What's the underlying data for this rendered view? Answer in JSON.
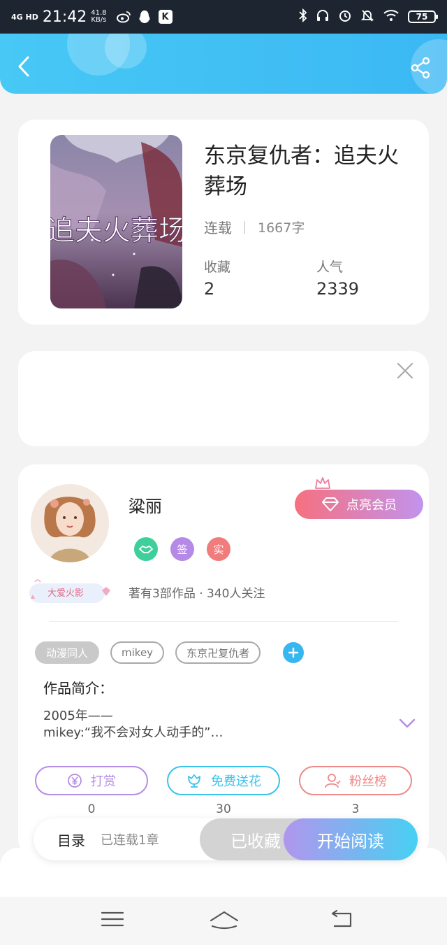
{
  "status_bar": {
    "signal": "4G HD",
    "time": "21:42",
    "net_speed_value": "41.8",
    "net_speed_unit": "KB/s",
    "k_app_label": "K",
    "battery": "75"
  },
  "header": {
    "back_icon": "chevron-left-icon",
    "share_icon": "share-icon"
  },
  "book": {
    "title": "东京复仇者：追夫火葬场",
    "status": "连载",
    "word_count": "1667字",
    "favorites_label": "收藏",
    "favorites_value": "2",
    "popularity_label": "人气",
    "popularity_value": "2339",
    "cover_text": "追夫火葬场"
  },
  "ad": {
    "close_icon": "close-icon"
  },
  "author": {
    "name": "粱丽",
    "badges": [
      {
        "icon": "handshake-icon",
        "label": "",
        "color": "#3ecf9b"
      },
      {
        "icon": "signed-icon",
        "label": "签",
        "color": "#b58ae6"
      },
      {
        "icon": "verified-icon",
        "label": "实",
        "color": "#f07c7c"
      }
    ],
    "vip_label": "点亮会员",
    "fan_tag": "大爱火影",
    "works_info": "著有3部作品 · 340人关注"
  },
  "tags": [
    "动漫同人",
    "mikey",
    "东京卍复仇者"
  ],
  "intro": {
    "title": "作品简介：",
    "text": "2005年——\nmikey:“我不会对女人动手的”…"
  },
  "actions": [
    {
      "label": "打赏",
      "count": "0",
      "color": "#b48de4",
      "icon": "reward-icon"
    },
    {
      "label": "免费送花",
      "count": "30",
      "color": "#3cc3ea",
      "icon": "flower-icon"
    },
    {
      "label": "粉丝榜",
      "count": "3",
      "color": "#ee8a8a",
      "icon": "fans-icon"
    }
  ],
  "bottom": {
    "toc_label": "目录",
    "chapter_info": "已连载1章",
    "collected_label": "已收藏",
    "start_label": "开始阅读"
  },
  "colors": {
    "accent": "#3bb8f4",
    "vip_gradient_start": "#f6707f",
    "vip_gradient_end": "#c293ee"
  }
}
